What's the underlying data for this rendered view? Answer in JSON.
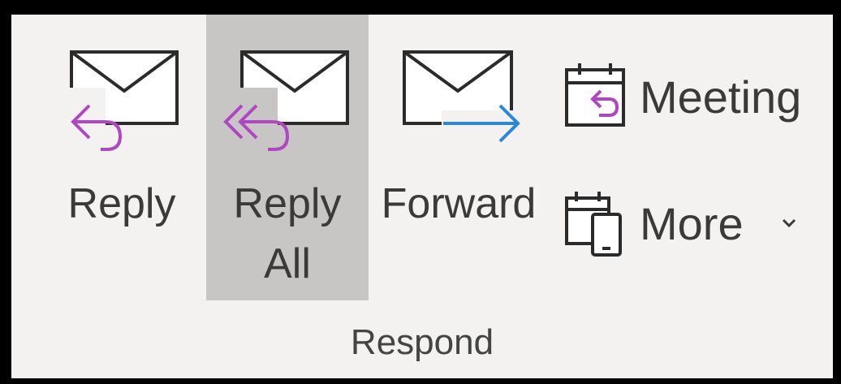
{
  "respond_group": {
    "label": "Respond",
    "buttons": {
      "reply": {
        "label": "Reply",
        "icon": "reply-icon"
      },
      "reply_all": {
        "label_line1": "Reply",
        "label_line2": "All",
        "icon": "reply-all-icon",
        "selected": true
      },
      "forward": {
        "label": "Forward",
        "icon": "forward-icon"
      },
      "meeting": {
        "label": "Meeting",
        "icon": "meeting-reply-icon"
      },
      "more": {
        "label": "More",
        "icon": "more-calendar-device-icon",
        "chevron": "chevron-down-icon"
      }
    }
  },
  "colors": {
    "background": "#f3f2f1",
    "selected": "#c8c6c4",
    "reply_arrow": "#b146c2",
    "forward_arrow": "#2b88d8",
    "icon_outline": "#2b2b2b"
  }
}
